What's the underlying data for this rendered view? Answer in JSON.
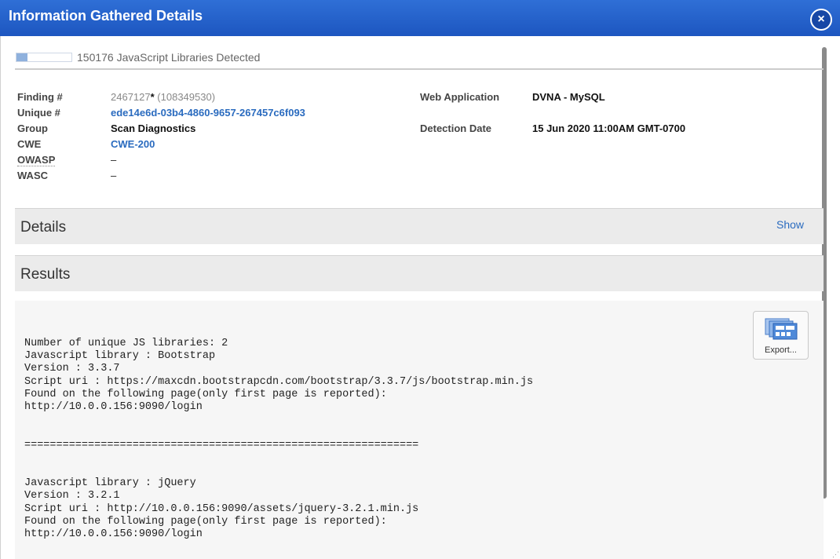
{
  "window": {
    "title": "Information Gathered Details",
    "close_icon": "×"
  },
  "header": {
    "severity_level_fraction": 0.2,
    "qid_title": "150176 JavaScript Libraries Detected"
  },
  "details": {
    "finding_label": "Finding #",
    "finding_value": "2467127",
    "finding_star": "*",
    "finding_ref": " (108349530)",
    "unique_label": "Unique #",
    "unique_value": "ede14e6d-03b4-4860-9657-267457c6f093",
    "group_label": "Group",
    "group_value": "Scan Diagnostics",
    "cwe_label": "CWE",
    "cwe_value": "CWE-200",
    "owasp_label": "OWASP",
    "owasp_value": "–",
    "wasc_label": "WASC",
    "wasc_value": "–",
    "webapp_label": "Web Application",
    "webapp_value": "DVNA - MySQL",
    "detection_label": "Detection Date",
    "detection_value": "15 Jun 2020 11:00AM GMT-0700"
  },
  "sections": {
    "details_heading": "Details",
    "details_toggle": "Show",
    "results_heading": "Results"
  },
  "results": {
    "export_label": "Export...",
    "text": "Number of unique JS libraries: 2\nJavascript library : Bootstrap\nVersion : 3.3.7\nScript uri : https://maxcdn.bootstrapcdn.com/bootstrap/3.3.7/js/bootstrap.min.js\nFound on the following page(only first page is reported):\nhttp://10.0.0.156:9090/login\n\n\n==============================================================\n\n\nJavascript library : jQuery\nVersion : 3.2.1\nScript uri : http://10.0.0.156:9090/assets/jquery-3.2.1.min.js\nFound on the following page(only first page is reported):\nhttp://10.0.0.156:9090/login"
  }
}
